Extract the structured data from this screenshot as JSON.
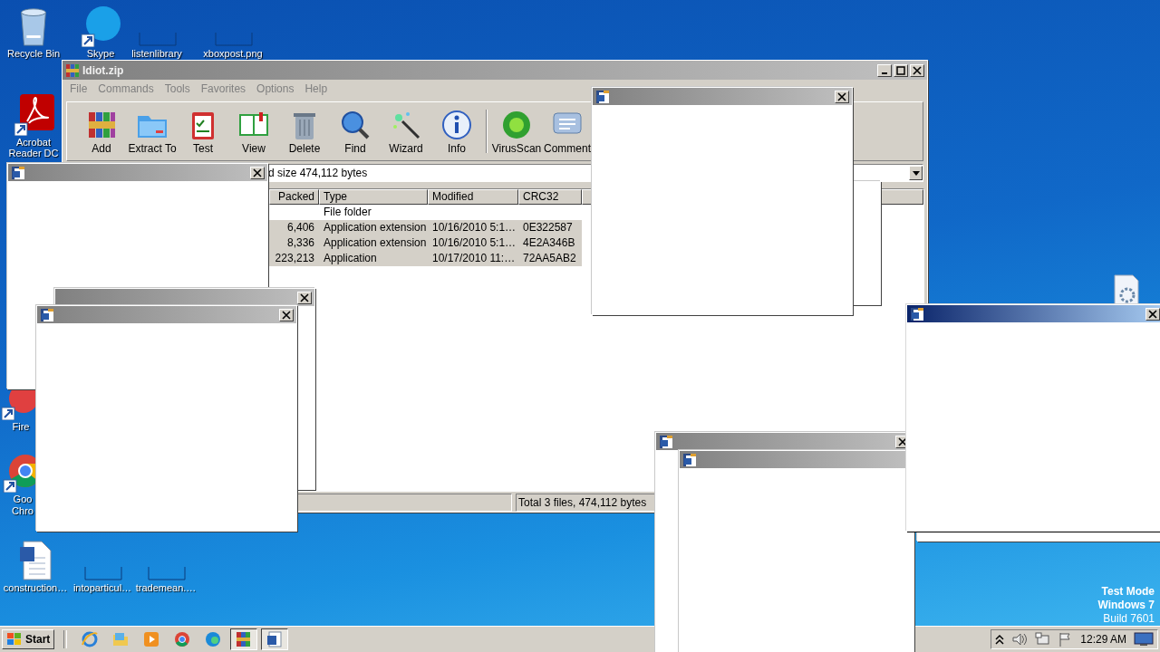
{
  "desktop_icons": [
    {
      "label": "Recycle Bin",
      "kind": "bin"
    },
    {
      "label": "Skype",
      "kind": "chat"
    },
    {
      "label": "listenlibrary",
      "kind": "blank"
    },
    {
      "label": "xboxpost.png",
      "kind": "blank"
    },
    {
      "label": "Acrobat Reader DC",
      "kind": "pdf"
    },
    {
      "label": "Fire",
      "kind": "fox"
    },
    {
      "label": "Goo Chro",
      "kind": "browser"
    },
    {
      "label": "construction…",
      "kind": "doc"
    },
    {
      "label": "intoparticul…",
      "kind": "blank"
    },
    {
      "label": "trademean.…",
      "kind": "blank"
    },
    {
      "kind": "gear"
    }
  ],
  "winrar": {
    "title": "Idiot.zip",
    "menu": [
      "File",
      "Commands",
      "Tools",
      "Favorites",
      "Options",
      "Help"
    ],
    "toolbar": [
      {
        "label": "Add",
        "kind": "add"
      },
      {
        "label": "Extract To",
        "kind": "extract"
      },
      {
        "label": "Test",
        "kind": "test"
      },
      {
        "label": "View",
        "kind": "view"
      },
      {
        "label": "Delete",
        "kind": "delete"
      },
      {
        "label": "Find",
        "kind": "find"
      },
      {
        "label": "Wizard",
        "kind": "wizard"
      },
      {
        "label": "Info",
        "kind": "info"
      },
      {
        "label": "VirusScan",
        "kind": "virus"
      },
      {
        "label": "Comment",
        "kind": "comment"
      }
    ],
    "address": "d size 474,112 bytes",
    "columns": [
      "Packed",
      "Type",
      "Modified",
      "CRC32"
    ],
    "rows": [
      {
        "packed": "",
        "type": "File folder",
        "modified": "",
        "crc": "",
        "selected": false
      },
      {
        "packed": "6,406",
        "type": "Application extension",
        "modified": "10/16/2010 5:1…",
        "crc": "0E322587",
        "selected": true
      },
      {
        "packed": "8,336",
        "type": "Application extension",
        "modified": "10/16/2010 5:1…",
        "crc": "4E2A346B",
        "selected": true
      },
      {
        "packed": "223,213",
        "type": "Application",
        "modified": "10/17/2010 11:…",
        "crc": "72AA5AB2",
        "selected": true
      }
    ],
    "status": "Total 3 files, 474,112 bytes"
  },
  "popups": [
    {
      "kind": "frame"
    },
    {
      "kind": "frame"
    },
    {
      "kind": "window",
      "active": false,
      "icon": true,
      "close": true
    },
    {
      "kind": "window",
      "active": false,
      "icon": false,
      "close": true
    },
    {
      "kind": "window",
      "active": false,
      "icon": true,
      "close": true
    },
    {
      "kind": "window",
      "active": false,
      "icon": true,
      "close": true
    },
    {
      "kind": "window",
      "active": false,
      "icon": true,
      "close": true
    },
    {
      "kind": "window",
      "active": false,
      "icon": true,
      "close": false
    },
    {
      "kind": "window",
      "active": true,
      "icon": true,
      "close": true
    }
  ],
  "os_notice": [
    "Test Mode",
    "Windows 7",
    "Build 7601"
  ],
  "taskbar": {
    "start": "Start",
    "apps": [
      {
        "kind": "ie",
        "open": false
      },
      {
        "kind": "folder",
        "open": false
      },
      {
        "kind": "media",
        "open": false
      },
      {
        "kind": "chrome",
        "open": false
      },
      {
        "kind": "edge",
        "open": false
      },
      {
        "kind": "winrar",
        "open": true
      },
      {
        "kind": "word",
        "open": true
      }
    ],
    "clock": "12:29 AM"
  }
}
